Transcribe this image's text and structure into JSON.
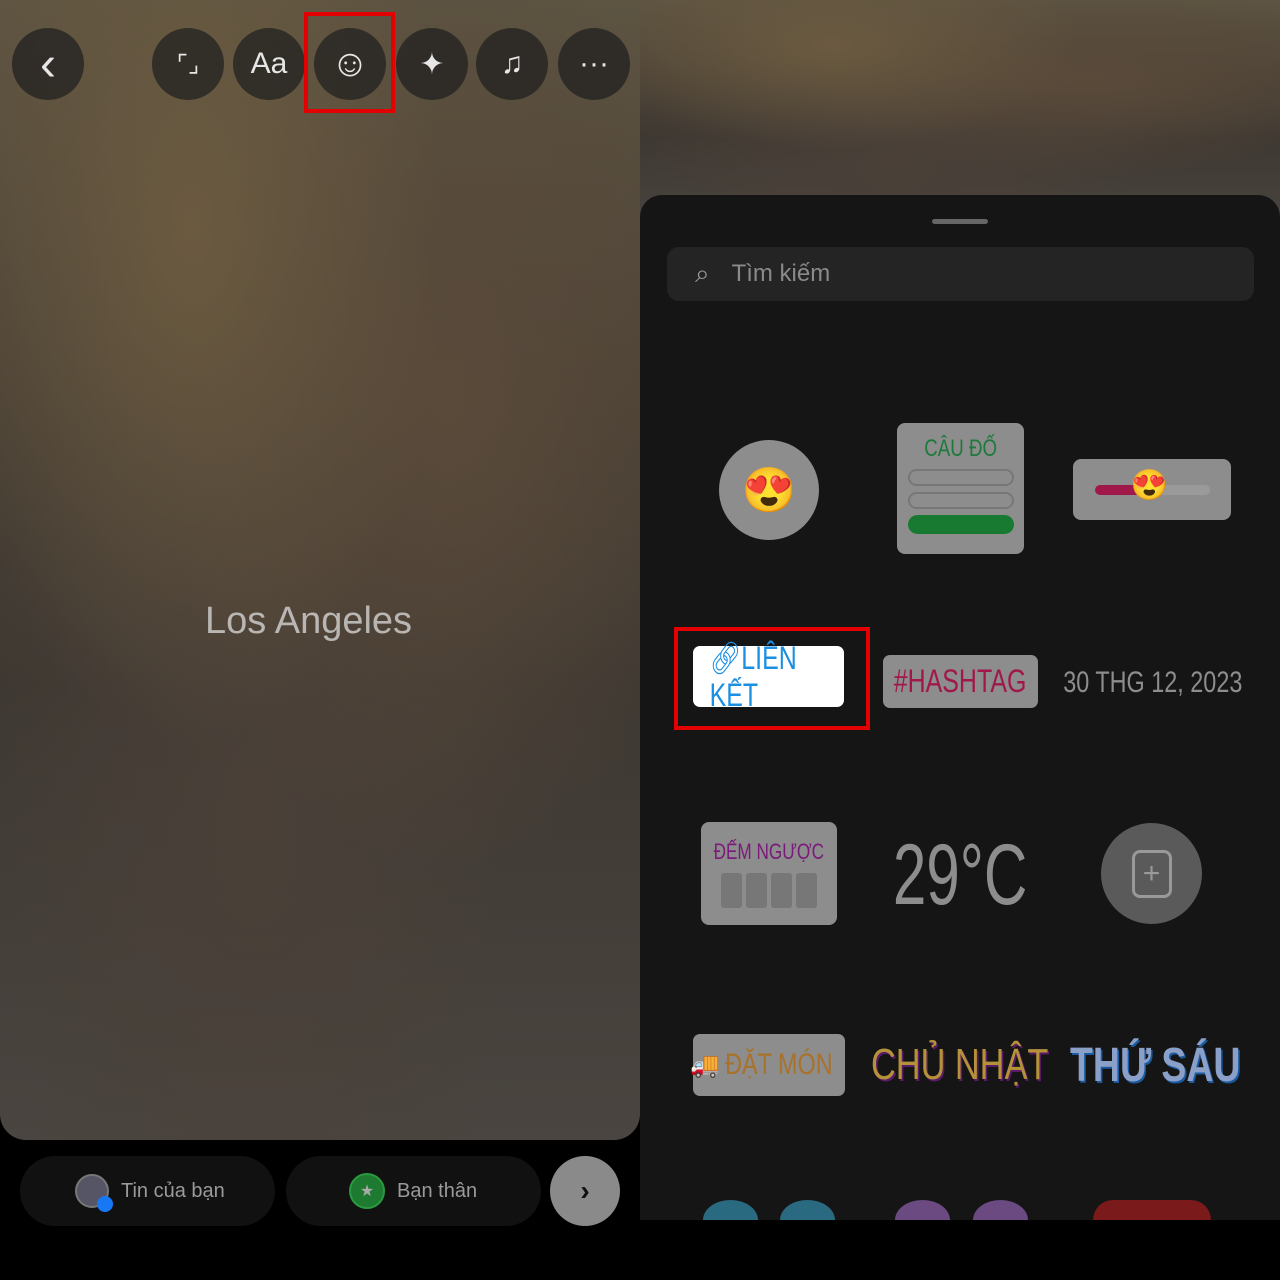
{
  "left_editor": {
    "toolbar": [
      {
        "name": "back",
        "icon": "chevron-left-icon",
        "glyph": "‹"
      },
      {
        "name": "resize",
        "icon": "expand-icon",
        "glyph": "⌜⌟"
      },
      {
        "name": "text",
        "label": "Aa"
      },
      {
        "name": "sticker",
        "icon": "sticker-icon",
        "glyph": "☺",
        "highlighted": true
      },
      {
        "name": "effects",
        "icon": "sparkles-icon",
        "glyph": "✦"
      },
      {
        "name": "music",
        "icon": "music-note-icon",
        "glyph": "♫"
      },
      {
        "name": "more",
        "icon": "more-icon",
        "glyph": "···"
      }
    ],
    "location_caption": "Los Angeles",
    "share": {
      "your_story": "Tin của bạn",
      "close_friends": "Bạn thân",
      "next_glyph": "›"
    }
  },
  "sticker_tray": {
    "search_placeholder": "Tìm kiếm",
    "stickers": {
      "emoji_reaction": "😍",
      "quiz": "CÂU ĐỐ",
      "slider_emoji": "😍",
      "link": "LIÊN KẾT",
      "hashtag": "#HASHTAG",
      "date": "30 THG 12, 2023",
      "countdown": "ĐẾM NGƯỢC",
      "temperature": "29°C",
      "food_order": "ĐẶT MÓN",
      "day_sunday": "CHỦ NHẬT",
      "day_friday": "THỨ SÁU"
    },
    "highlighted_sticker": "link"
  },
  "colors": {
    "highlight": "#e30000",
    "link_blue": "#1a8fe3",
    "hashtag": "#c2185b",
    "quiz_green": "#1e9a3c"
  }
}
